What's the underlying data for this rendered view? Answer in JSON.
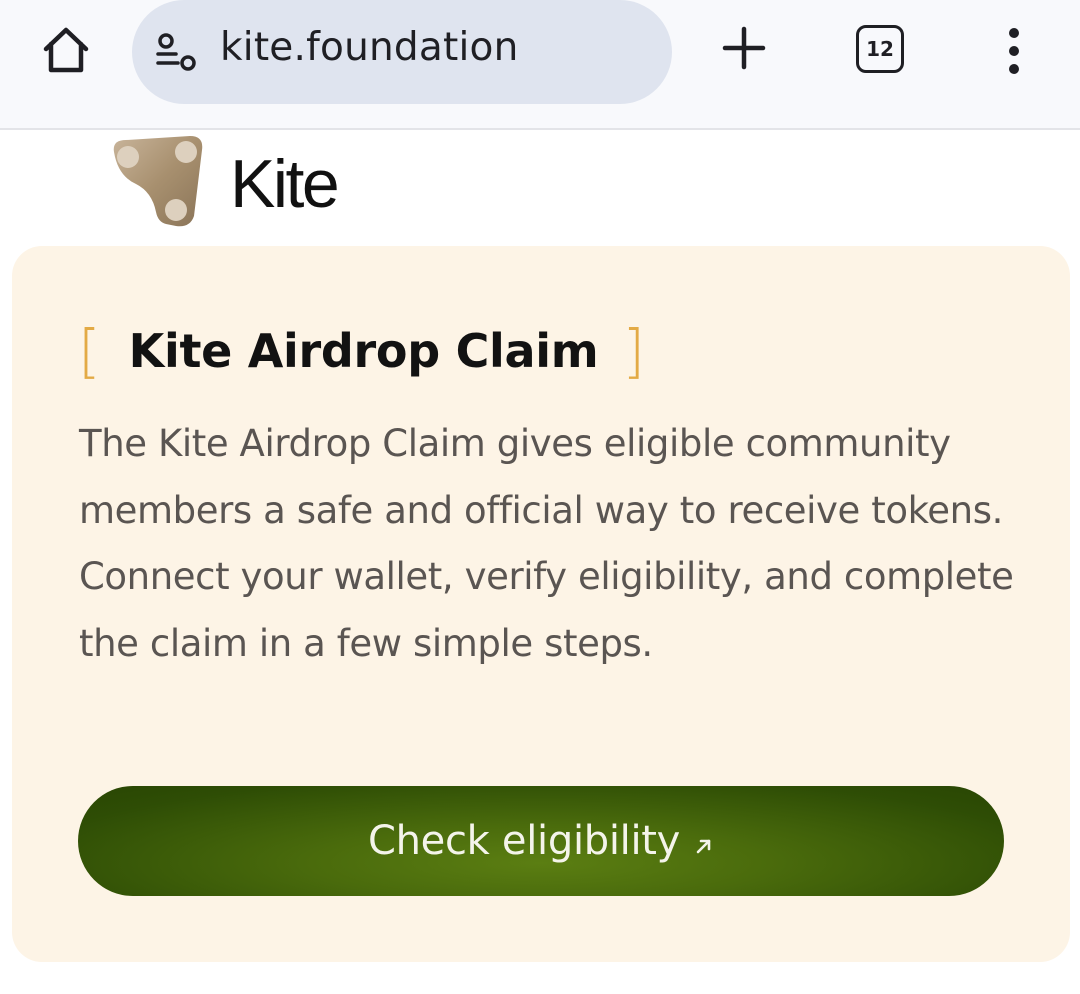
{
  "browser": {
    "url": "kite.foundation",
    "tab_count": "12"
  },
  "site": {
    "name": "Kite"
  },
  "card": {
    "title": "Kite Airdrop Claim",
    "bracket_open": "[",
    "bracket_close": "]",
    "description": "The Kite Airdrop Claim gives eligible community members a safe and official way to receive tokens. Connect your wallet, verify eligibility, and complete the claim in a few simple steps.",
    "cta_label": "Check eligibility"
  },
  "icons": {
    "home": "home-icon",
    "site_info": "tune-icon",
    "new_tab": "plus-icon",
    "tabs": "tab-counter-icon",
    "menu": "more-vert-icon",
    "cta_arrow": "arrow-up-right-icon"
  },
  "colors": {
    "card_background": "#fdf4e6",
    "bracket": "#e3aa45",
    "cta_background": "#3d5e0a",
    "url_pill": "#dfe4ef"
  }
}
